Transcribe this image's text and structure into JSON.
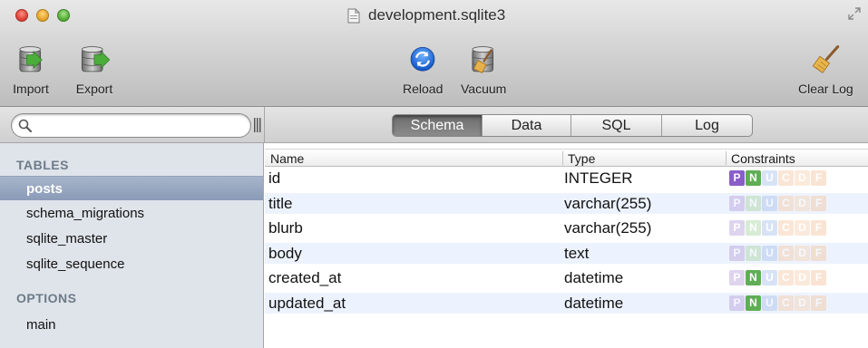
{
  "window": {
    "title": "development.sqlite3"
  },
  "toolbar": {
    "import_label": "Import",
    "export_label": "Export",
    "reload_label": "Reload",
    "vacuum_label": "Vacuum",
    "clear_log_label": "Clear Log"
  },
  "search": {
    "value": "",
    "placeholder": ""
  },
  "tabs": [
    {
      "label": "Schema",
      "active": true
    },
    {
      "label": "Data",
      "active": false
    },
    {
      "label": "SQL",
      "active": false
    },
    {
      "label": "Log",
      "active": false
    }
  ],
  "sidebar": {
    "tables_heading": "TABLES",
    "tables": [
      {
        "label": "posts",
        "selected": true
      },
      {
        "label": "schema_migrations",
        "selected": false
      },
      {
        "label": "sqlite_master",
        "selected": false
      },
      {
        "label": "sqlite_sequence",
        "selected": false
      }
    ],
    "options_heading": "OPTIONS",
    "options": [
      {
        "label": "main"
      }
    ]
  },
  "schema": {
    "columns": [
      "Name",
      "Type",
      "Constraints"
    ],
    "constraint_letters": [
      "P",
      "N",
      "U",
      "C",
      "D",
      "F"
    ],
    "rows": [
      {
        "name": "id",
        "type": "INTEGER",
        "constraints": {
          "P": true,
          "N": true,
          "U": false,
          "C": false,
          "D": false,
          "F": false
        }
      },
      {
        "name": "title",
        "type": "varchar(255)",
        "constraints": {
          "P": false,
          "N": false,
          "U": false,
          "C": false,
          "D": false,
          "F": false
        }
      },
      {
        "name": "blurb",
        "type": "varchar(255)",
        "constraints": {
          "P": false,
          "N": false,
          "U": false,
          "C": false,
          "D": false,
          "F": false
        }
      },
      {
        "name": "body",
        "type": "text",
        "constraints": {
          "P": false,
          "N": false,
          "U": false,
          "C": false,
          "D": false,
          "F": false
        }
      },
      {
        "name": "created_at",
        "type": "datetime",
        "constraints": {
          "P": false,
          "N": true,
          "U": false,
          "C": false,
          "D": false,
          "F": false
        }
      },
      {
        "name": "updated_at",
        "type": "datetime",
        "constraints": {
          "P": false,
          "N": true,
          "U": false,
          "C": false,
          "D": false,
          "F": false
        }
      }
    ]
  },
  "colors": {
    "sidebar_bg": "#dfe4ea",
    "selection": "#8a9bb7",
    "alt_row": "#edf3fe",
    "constraint_p": "#8a5ec7",
    "constraint_n": "#5fae55"
  }
}
